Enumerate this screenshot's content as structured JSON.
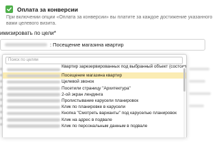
{
  "conversion_payment": {
    "title": "Оплата за конверсии",
    "checked": true,
    "accent_color": "#4fb04a",
    "description": "При включении опции «Оплата за конверсии» вы платите за каждое достижение указанного вами целевого визита."
  },
  "optimize": {
    "label": "имизировать по цели*",
    "selected_value": ": Посещение магазина квартир"
  },
  "dropdown": {
    "search_placeholder": "Поиск по целям",
    "highlight_color": "#fbecb3",
    "items": [
      {
        "label": "Квартир зарезервированных под выбранный объект (состоявшаяся запись)"
      },
      {
        "label": "Посещение магазина квартир",
        "highlighted": true
      },
      {
        "label": "Целевой звонок"
      },
      {
        "label": "Посетили страницу \"Архитектура\""
      },
      {
        "label": "2-ой экран лендинга"
      },
      {
        "label": "Пролистывание карусели планировок"
      },
      {
        "label": "Клик по планировке в карусели"
      },
      {
        "label": "Кнопка \"Смотреть варианты\" под каруселью планировок"
      },
      {
        "label": "Клик на адрес в подвале"
      },
      {
        "label": "Клик по персональным данным в подвале"
      }
    ]
  }
}
